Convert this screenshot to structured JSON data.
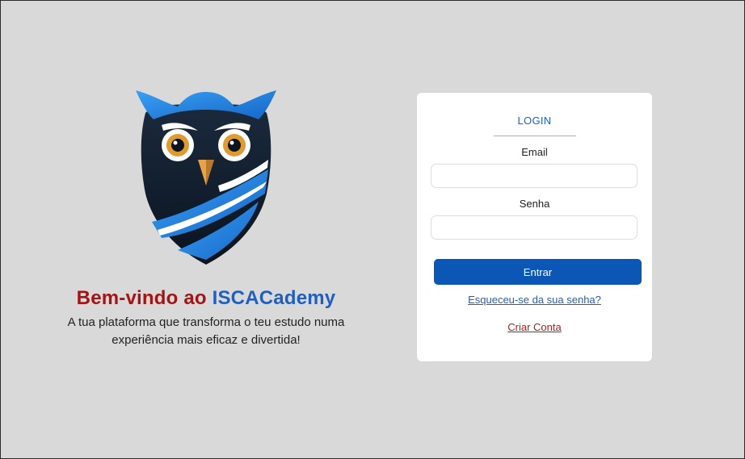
{
  "hero": {
    "welcome_prefix": "Bem-vindo ao ",
    "brand_part1": "ISCAC",
    "brand_part2": "ademy",
    "tagline": "A tua plataforma que transforma o teu estudo numa experiência mais eficaz e divertida!",
    "logo_icon": "owl-logo-icon"
  },
  "login": {
    "title": "LOGIN",
    "email_label": "Email",
    "email_value": "",
    "password_label": "Senha",
    "password_value": "",
    "submit_label": "Entrar",
    "forgot_label": "Esqueceu-se da sua senha?",
    "create_label": "Criar Conta"
  },
  "colors": {
    "background": "#d9d9d9",
    "brand_blue": "#1f5fbf",
    "brand_red": "#a31515",
    "button_blue": "#0c56b5"
  }
}
